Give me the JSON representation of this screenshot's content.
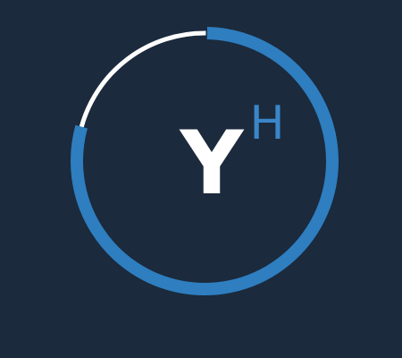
{
  "logo": {
    "letter": "Y",
    "superscript": "H"
  },
  "progress_ring": {
    "fraction_filled": 0.79,
    "fill_color": "#2e7ec0",
    "track_color": "#ffffff",
    "background_color": "#1b2a3c"
  }
}
